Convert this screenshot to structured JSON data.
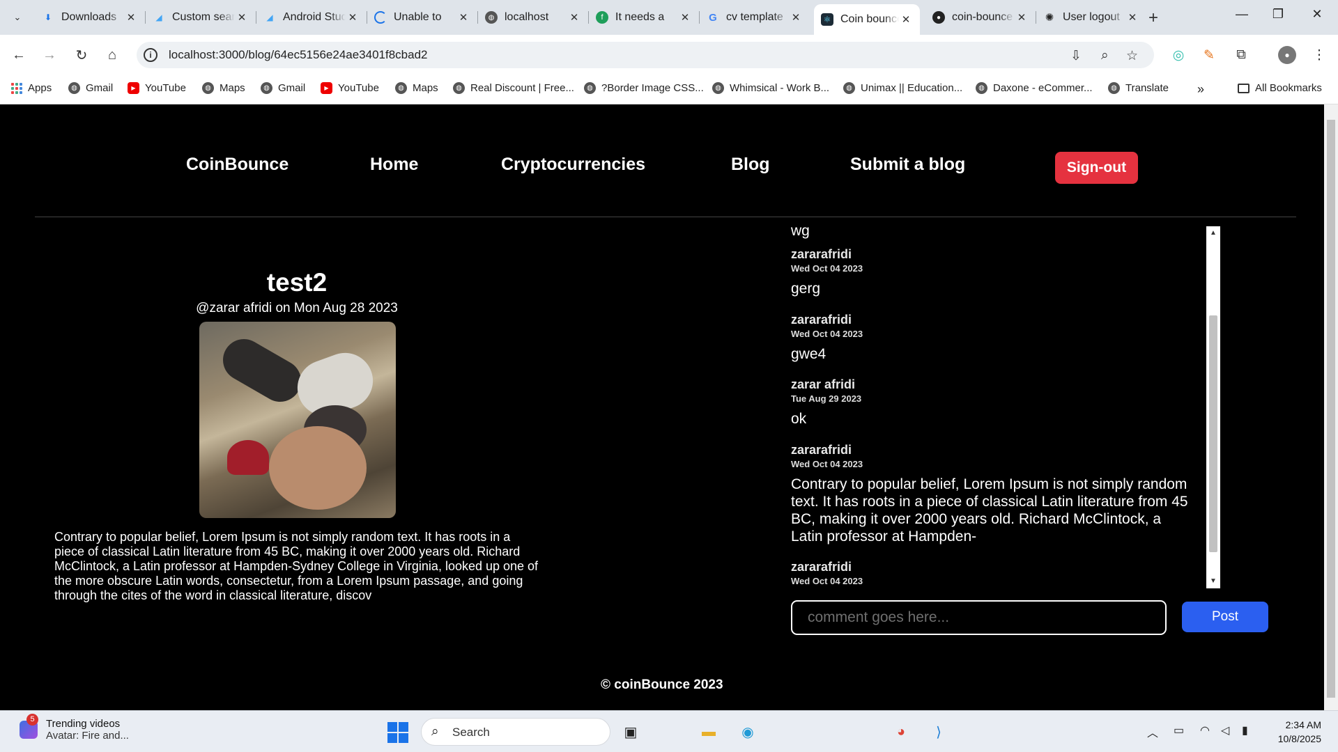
{
  "browser": {
    "tabs": [
      {
        "title": "Downloads",
        "icon": "download-icon"
      },
      {
        "title": "Custom search",
        "icon": "flutter-icon"
      },
      {
        "title": "Android Studio",
        "icon": "flutter-icon"
      },
      {
        "title": "Unable to",
        "icon": "loading-icon"
      },
      {
        "title": "localhost",
        "icon": "globe-icon"
      },
      {
        "title": "It needs a",
        "icon": "app-icon"
      },
      {
        "title": "cv template",
        "icon": "google-icon"
      },
      {
        "title": "Coin bounce",
        "icon": "react-icon",
        "active": true
      },
      {
        "title": "coin-bounce",
        "icon": "github-icon"
      },
      {
        "title": "User logout",
        "icon": "openai-icon"
      }
    ],
    "url": "localhost:3000/blog/64ec5156e24ae3401f8cbad2",
    "bookmarks": [
      "Apps",
      "Gmail",
      "YouTube",
      "Maps",
      "Gmail",
      "YouTube",
      "Maps",
      "Real Discount | Free...",
      "?Border Image CSS...",
      "Whimsical - Work B...",
      "Unimax || Education...",
      "Daxone - eCommer...",
      "Translate"
    ],
    "all_bookmarks": "All Bookmarks"
  },
  "nav": {
    "brand": "CoinBounce",
    "home": "Home",
    "crypto": "Cryptocurrencies",
    "blog": "Blog",
    "submit": "Submit a blog",
    "signout": "Sign-out"
  },
  "post": {
    "title": "test2",
    "meta": "@zarar afridi on Mon Aug 28 2023",
    "body": "Contrary to popular belief, Lorem Ipsum is not simply random text. It has roots in a piece of classical Latin literature from 45 BC, making it over 2000 years old. Richard McClintock, a Latin professor at Hampden-Sydney College in Virginia, looked up one of the more obscure Latin words, consectetur, from a Lorem Ipsum passage, and going through the cites of the word in classical literature, discov"
  },
  "comments": {
    "partial_top": "wg",
    "items": [
      {
        "author": "zararafridi",
        "date": "Wed Oct 04 2023",
        "text": "gerg"
      },
      {
        "author": "zararafridi",
        "date": "Wed Oct 04 2023",
        "text": "gwe4"
      },
      {
        "author": "zarar afridi",
        "date": "Tue Aug 29 2023",
        "text": "ok"
      },
      {
        "author": "zararafridi",
        "date": "Wed Oct 04 2023",
        "text": "Contrary to popular belief, Lorem Ipsum is not simply random text. It has roots in a piece of classical Latin literature from 45 BC, making it over 2000 years old. Richard McClintock, a Latin professor at Hampden-"
      },
      {
        "author": "zararafridi",
        "date": "Wed Oct 04 2023",
        "text": ""
      }
    ],
    "placeholder": "comment goes here...",
    "post_label": "Post"
  },
  "footer": "© coinBounce 2023",
  "taskbar": {
    "widget_badge": "5",
    "widget_title": "Trending videos",
    "widget_sub": "Avatar: Fire and...",
    "search": "Search",
    "time": "2:34 AM",
    "date": "10/8/2025"
  },
  "colors": {
    "signout": "#e5323f",
    "post_button": "#2b5ff0",
    "page_bg": "#000000"
  }
}
